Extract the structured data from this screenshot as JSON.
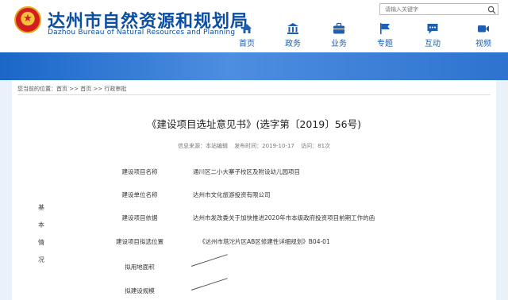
{
  "header": {
    "title": "达州市自然资源和规划局",
    "subtitle": "Dazhou Bureau of Natural Resources and Planning",
    "search_placeholder": "请输入关键字"
  },
  "nav": {
    "items": [
      {
        "label": "首页",
        "icon": "home-icon"
      },
      {
        "label": "政务",
        "icon": "building-icon"
      },
      {
        "label": "业务",
        "icon": "briefcase-icon"
      },
      {
        "label": "专题",
        "icon": "flag-icon"
      },
      {
        "label": "互动",
        "icon": "chat-icon"
      },
      {
        "label": "视频",
        "icon": "video-icon"
      }
    ]
  },
  "breadcrumb": {
    "prefix": "您当前的位置：",
    "home": "首页",
    "sep1": ">>",
    "level2": "首页",
    "sep2": ">>",
    "level3": "行政审批"
  },
  "article": {
    "title": "《建设项目选址意见书》(选字第〔2019〕56号)",
    "source": "信息来源：本站编辑",
    "date": "发布时间：2019-10-17",
    "views": "访问：81次"
  },
  "side_label": [
    "基",
    "本",
    "情",
    "况"
  ],
  "rows": [
    {
      "label": "建设项目名称",
      "value": "通川区二小大寨子校区及附设幼儿园项目"
    },
    {
      "label": "建设单位名称",
      "value": "达州市文化旅游投资有限公司"
    },
    {
      "label": "建设项目依据",
      "value": "达州市发改委关于加快推进2020年市本级政府投资项目前期工作的函"
    },
    {
      "label": "建设项目拟选位置",
      "value": "《达州市塔沱片区AB区修建性详细规划》B04-01"
    },
    {
      "label": "拟用地面积",
      "value": ""
    },
    {
      "label": "拟建设规模",
      "value": ""
    }
  ],
  "colors": {
    "brand": "#0b4ea2",
    "banner": "#1a67c8",
    "background": "#e9f1fa"
  }
}
